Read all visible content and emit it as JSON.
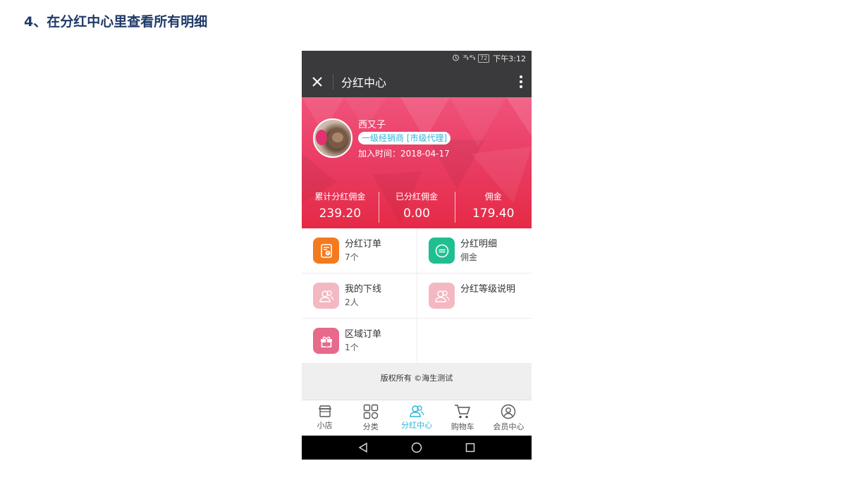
{
  "slide": {
    "title": "4、在分红中心里查看所有明细"
  },
  "status_bar": {
    "network": "²⁶ᵢₗₗ ⁴ᴳᵢₗₗ",
    "battery": "72",
    "time": "下午3:12"
  },
  "nav": {
    "title": "分红中心"
  },
  "user": {
    "name": "西又子",
    "level": "一级经销商 [市级代理]",
    "join_label": "加入时间：",
    "join_date": "2018-04-17"
  },
  "stats": [
    {
      "label": "累计分红佣金",
      "value": "239.20"
    },
    {
      "label": "已分红佣金",
      "value": "0.00"
    },
    {
      "label": "佣金",
      "value": "179.40"
    }
  ],
  "grid": [
    {
      "title": "分红订单",
      "sub": "7个",
      "icon": "receipt-icon",
      "color": "#f47a1f"
    },
    {
      "title": "分红明细",
      "sub": "佣金",
      "icon": "list-icon",
      "color": "#1fbf91"
    },
    {
      "title": "我的下线",
      "sub": "2人",
      "icon": "users-icon",
      "color": "#f3b8c2"
    },
    {
      "title": "分红等级说明",
      "sub": "",
      "icon": "users-icon",
      "color": "#f3b8c2"
    },
    {
      "title": "区域订单",
      "sub": "1个",
      "icon": "gift-icon",
      "color": "#e76a8a"
    }
  ],
  "footer": {
    "copyright": "版权所有 ©海生测试"
  },
  "tabs": [
    {
      "label": "小店",
      "icon": "shop-icon"
    },
    {
      "label": "分类",
      "icon": "category-icon"
    },
    {
      "label": "分红中心",
      "icon": "users-icon",
      "active": true
    },
    {
      "label": "购物车",
      "icon": "cart-icon"
    },
    {
      "label": "会员中心",
      "icon": "member-icon"
    }
  ],
  "colors": {
    "accent": "#2fb4d8",
    "banner": "#ea3e66",
    "nav": "#3a3a3c"
  }
}
